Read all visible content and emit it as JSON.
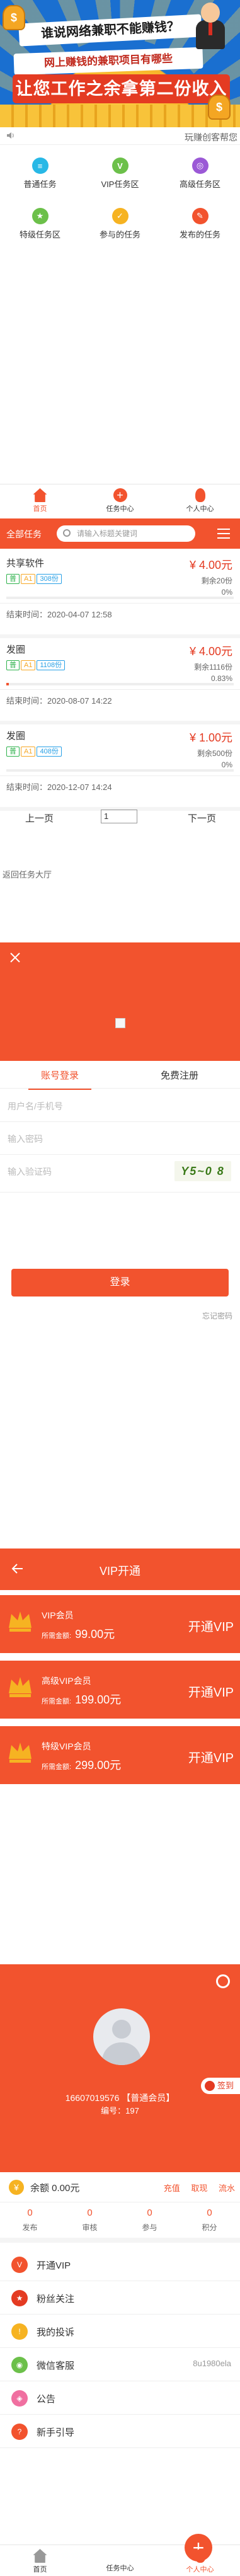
{
  "banner": {
    "title": "谁说网络兼职不能赚钱？",
    "subtitle": "网上赚钱的兼职项目有哪些",
    "main": "让您工作之余拿第二份收入",
    "bag_char": "$"
  },
  "notice": {
    "text": "玩赚创客帮您"
  },
  "grid": [
    {
      "label": "普通任务",
      "color": "#28b8e6",
      "glyph": "≡"
    },
    {
      "label": "VIP任务区",
      "color": "#6cc04a",
      "glyph": "V"
    },
    {
      "label": "高级任务区",
      "color": "#9b59d6",
      "glyph": "◎"
    },
    {
      "label": "特级任务区",
      "color": "#6cc04a",
      "glyph": "★"
    },
    {
      "label": "参与的任务",
      "color": "#f6b322",
      "glyph": "✓"
    },
    {
      "label": "发布的任务",
      "color": "#f2532e",
      "glyph": "✎"
    }
  ],
  "tabs": {
    "home": "首页",
    "task": "任务中心",
    "me": "个人中心"
  },
  "list": {
    "all": "全部任务",
    "search_placeholder": "请输入标题关键词"
  },
  "tasks": [
    {
      "name": "共享软件",
      "price": "¥ 4.00元",
      "tags": [
        "普",
        "A1",
        "308份"
      ],
      "remain": "剩余20份",
      "pct": "0%",
      "progress": 0,
      "end": "结束时间：2020-04-07 12:58"
    },
    {
      "name": "发圈",
      "price": "¥ 4.00元",
      "tags": [
        "普",
        "A1",
        "1108份"
      ],
      "remain": "剩余1116份",
      "pct": "0.83%",
      "progress": 0.0083,
      "end": "结束时间：2020-08-07 14:22"
    },
    {
      "name": "发圈",
      "price": "¥ 1.00元",
      "tags": [
        "普",
        "A1",
        "408份"
      ],
      "remain": "剩余500份",
      "pct": "0%",
      "progress": 0,
      "end": "结束时间：2020-12-07 14:24"
    }
  ],
  "tag_colors": [
    "#2fb24c",
    "#f6a623",
    "#28a0e6"
  ],
  "pager": {
    "prev": "上一页",
    "page": "1",
    "next": "下一页"
  },
  "history": "返回任务大厅",
  "login": {
    "tab_login": "账号登录",
    "tab_register": "免费注册",
    "username_ph": "用户名/手机号",
    "password_ph": "输入密码",
    "captcha_ph": "输入验证码",
    "captcha": "Y5~0 8",
    "button": "登录",
    "forgot": "忘记密码"
  },
  "vip": {
    "title": "VIP开通",
    "fee_label": "所需金额:",
    "button": "开通VIP",
    "levels": [
      {
        "name": "VIP会员",
        "fee": "99.00元",
        "crown": "#f6b322"
      },
      {
        "name": "高级VIP会员",
        "fee": "199.00元",
        "crown": "#f6b322"
      },
      {
        "name": "特级VIP会员",
        "fee": "299.00元",
        "crown": "#f6b322"
      }
    ]
  },
  "profile": {
    "sign": "签到",
    "phone": "16607019576 【普通会员】",
    "uid": "编号：197",
    "balance": "余额 0.00元",
    "actions": "充值 取现 流水",
    "stats": [
      {
        "value": "0",
        "label": "发布"
      },
      {
        "value": "0",
        "label": "审核"
      },
      {
        "value": "0",
        "label": "参与"
      },
      {
        "value": "0",
        "label": "积分"
      }
    ],
    "menu": [
      {
        "label": "开通VIP",
        "color": "#f2532e",
        "glyph": "V",
        "right": ""
      },
      {
        "label": "粉丝关注",
        "color": "#e43b22",
        "glyph": "★",
        "right": ""
      },
      {
        "label": "我的投诉",
        "color": "#f6b322",
        "glyph": "!",
        "right": ""
      },
      {
        "label": "微信客服",
        "color": "#6cc04a",
        "glyph": "◉",
        "right": "8u1980ela"
      },
      {
        "label": "公告",
        "color": "#f06fa0",
        "glyph": "◈",
        "right": ""
      },
      {
        "label": "新手引导",
        "color": "#f2532e",
        "glyph": "?",
        "right": ""
      }
    ]
  }
}
